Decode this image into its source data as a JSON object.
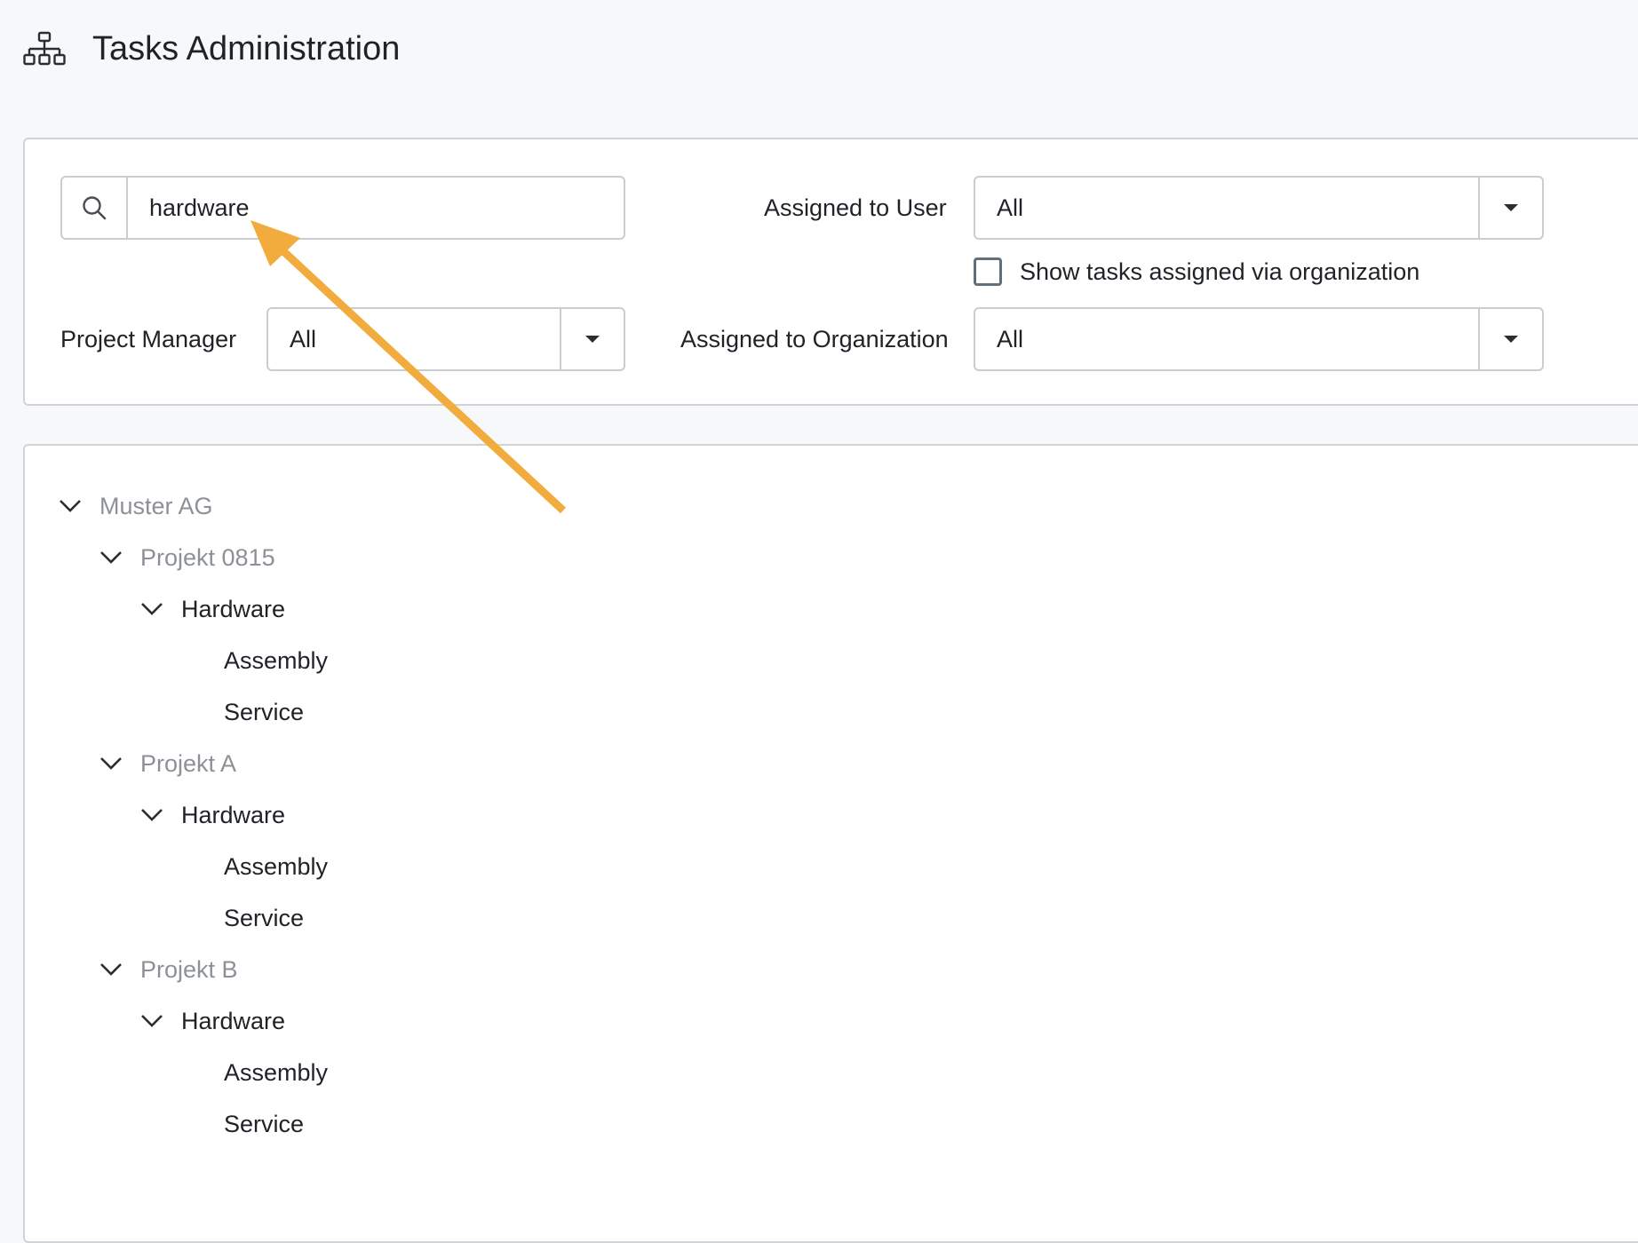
{
  "header": {
    "title": "Tasks Administration",
    "icon": "sitemap-icon"
  },
  "filters": {
    "search": {
      "value": "hardware",
      "icon": "search-icon"
    },
    "assigned_user": {
      "label": "Assigned to User",
      "value": "All"
    },
    "show_via_org": {
      "label": "Show tasks assigned via organization",
      "checked": false
    },
    "project_manager": {
      "label": "Project Manager",
      "value": "All"
    },
    "assigned_org": {
      "label": "Assigned to Organization",
      "value": "All"
    }
  },
  "tree": {
    "root": "Muster AG",
    "projects": [
      {
        "name": "Projekt 0815",
        "groups": [
          {
            "name": "Hardware",
            "tasks": [
              "Assembly",
              "Service"
            ]
          }
        ]
      },
      {
        "name": "Projekt A",
        "groups": [
          {
            "name": "Hardware",
            "tasks": [
              "Assembly",
              "Service"
            ]
          }
        ]
      },
      {
        "name": "Projekt B",
        "groups": [
          {
            "name": "Hardware",
            "tasks": [
              "Assembly",
              "Service"
            ]
          }
        ]
      }
    ]
  },
  "colors": {
    "annotation_arrow": "#f2ac3e",
    "muted_text": "#8d9197",
    "border": "#c9cdd2"
  }
}
